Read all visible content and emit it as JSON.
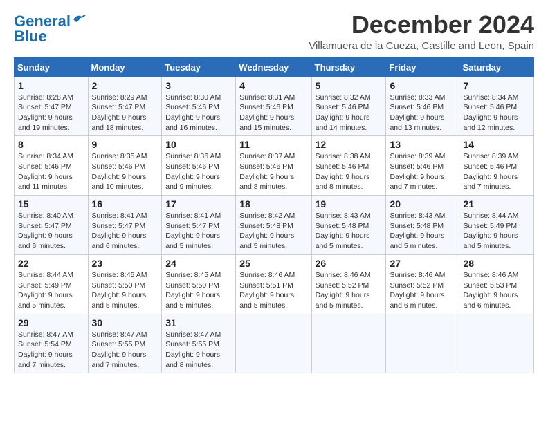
{
  "logo": {
    "line1": "General",
    "line2": "Blue"
  },
  "title": "December 2024",
  "location": "Villamuera de la Cueza, Castille and Leon, Spain",
  "headers": [
    "Sunday",
    "Monday",
    "Tuesday",
    "Wednesday",
    "Thursday",
    "Friday",
    "Saturday"
  ],
  "weeks": [
    [
      {
        "day": "1",
        "info": "Sunrise: 8:28 AM\nSunset: 5:47 PM\nDaylight: 9 hours and 19 minutes."
      },
      {
        "day": "2",
        "info": "Sunrise: 8:29 AM\nSunset: 5:47 PM\nDaylight: 9 hours and 18 minutes."
      },
      {
        "day": "3",
        "info": "Sunrise: 8:30 AM\nSunset: 5:46 PM\nDaylight: 9 hours and 16 minutes."
      },
      {
        "day": "4",
        "info": "Sunrise: 8:31 AM\nSunset: 5:46 PM\nDaylight: 9 hours and 15 minutes."
      },
      {
        "day": "5",
        "info": "Sunrise: 8:32 AM\nSunset: 5:46 PM\nDaylight: 9 hours and 14 minutes."
      },
      {
        "day": "6",
        "info": "Sunrise: 8:33 AM\nSunset: 5:46 PM\nDaylight: 9 hours and 13 minutes."
      },
      {
        "day": "7",
        "info": "Sunrise: 8:34 AM\nSunset: 5:46 PM\nDaylight: 9 hours and 12 minutes."
      }
    ],
    [
      {
        "day": "8",
        "info": "Sunrise: 8:34 AM\nSunset: 5:46 PM\nDaylight: 9 hours and 11 minutes."
      },
      {
        "day": "9",
        "info": "Sunrise: 8:35 AM\nSunset: 5:46 PM\nDaylight: 9 hours and 10 minutes."
      },
      {
        "day": "10",
        "info": "Sunrise: 8:36 AM\nSunset: 5:46 PM\nDaylight: 9 hours and 9 minutes."
      },
      {
        "day": "11",
        "info": "Sunrise: 8:37 AM\nSunset: 5:46 PM\nDaylight: 9 hours and 8 minutes."
      },
      {
        "day": "12",
        "info": "Sunrise: 8:38 AM\nSunset: 5:46 PM\nDaylight: 9 hours and 8 minutes."
      },
      {
        "day": "13",
        "info": "Sunrise: 8:39 AM\nSunset: 5:46 PM\nDaylight: 9 hours and 7 minutes."
      },
      {
        "day": "14",
        "info": "Sunrise: 8:39 AM\nSunset: 5:46 PM\nDaylight: 9 hours and 7 minutes."
      }
    ],
    [
      {
        "day": "15",
        "info": "Sunrise: 8:40 AM\nSunset: 5:47 PM\nDaylight: 9 hours and 6 minutes."
      },
      {
        "day": "16",
        "info": "Sunrise: 8:41 AM\nSunset: 5:47 PM\nDaylight: 9 hours and 6 minutes."
      },
      {
        "day": "17",
        "info": "Sunrise: 8:41 AM\nSunset: 5:47 PM\nDaylight: 9 hours and 5 minutes."
      },
      {
        "day": "18",
        "info": "Sunrise: 8:42 AM\nSunset: 5:48 PM\nDaylight: 9 hours and 5 minutes."
      },
      {
        "day": "19",
        "info": "Sunrise: 8:43 AM\nSunset: 5:48 PM\nDaylight: 9 hours and 5 minutes."
      },
      {
        "day": "20",
        "info": "Sunrise: 8:43 AM\nSunset: 5:48 PM\nDaylight: 9 hours and 5 minutes."
      },
      {
        "day": "21",
        "info": "Sunrise: 8:44 AM\nSunset: 5:49 PM\nDaylight: 9 hours and 5 minutes."
      }
    ],
    [
      {
        "day": "22",
        "info": "Sunrise: 8:44 AM\nSunset: 5:49 PM\nDaylight: 9 hours and 5 minutes."
      },
      {
        "day": "23",
        "info": "Sunrise: 8:45 AM\nSunset: 5:50 PM\nDaylight: 9 hours and 5 minutes."
      },
      {
        "day": "24",
        "info": "Sunrise: 8:45 AM\nSunset: 5:50 PM\nDaylight: 9 hours and 5 minutes."
      },
      {
        "day": "25",
        "info": "Sunrise: 8:46 AM\nSunset: 5:51 PM\nDaylight: 9 hours and 5 minutes."
      },
      {
        "day": "26",
        "info": "Sunrise: 8:46 AM\nSunset: 5:52 PM\nDaylight: 9 hours and 5 minutes."
      },
      {
        "day": "27",
        "info": "Sunrise: 8:46 AM\nSunset: 5:52 PM\nDaylight: 9 hours and 6 minutes."
      },
      {
        "day": "28",
        "info": "Sunrise: 8:46 AM\nSunset: 5:53 PM\nDaylight: 9 hours and 6 minutes."
      }
    ],
    [
      {
        "day": "29",
        "info": "Sunrise: 8:47 AM\nSunset: 5:54 PM\nDaylight: 9 hours and 7 minutes."
      },
      {
        "day": "30",
        "info": "Sunrise: 8:47 AM\nSunset: 5:55 PM\nDaylight: 9 hours and 7 minutes."
      },
      {
        "day": "31",
        "info": "Sunrise: 8:47 AM\nSunset: 5:55 PM\nDaylight: 9 hours and 8 minutes."
      },
      null,
      null,
      null,
      null
    ]
  ]
}
